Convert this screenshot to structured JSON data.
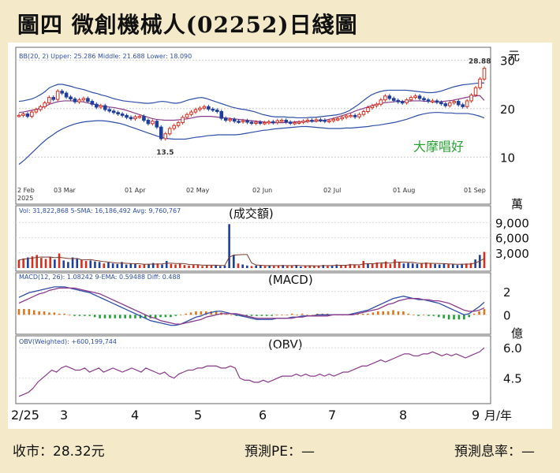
{
  "title": "圖四  微創機械人(02252)日綫圖",
  "footer": {
    "close_label": "收市：28.32元",
    "pe_label": "預測PE：—",
    "yield_label": "預測息率：—"
  },
  "colors": {
    "up": "#d62f1e",
    "down": "#1f3f9e",
    "band": "#2f4fa8",
    "middle": "#8b3a8b",
    "green": "#21a136",
    "orange": "#e0761c",
    "accent": "#2aa335"
  },
  "chart_data": [
    {
      "type": "line",
      "panel": "price",
      "legend_text": "BB(20, 2)  Upper: 25.286  Middle: 21.688  Lower: 18.090",
      "ytick_labels": [
        "30",
        "20",
        "10"
      ],
      "yticks": [
        30,
        20,
        10
      ],
      "ylim": [
        5,
        32
      ],
      "y_unit_label": "元",
      "x_date_labels": [
        "2 Feb",
        "03 Mar",
        "01 Apr",
        "02 May",
        "02 Jun",
        "02 Jul",
        "01 Aug",
        "01 Sep"
      ],
      "x_year_label": "2025",
      "annotations": [
        "13.5",
        "28.88"
      ],
      "caption": "大摩唱好",
      "close_prices": [
        18.6,
        18.9,
        18.4,
        19.3,
        19.8,
        20.4,
        21.2,
        22.3,
        21.9,
        23.6,
        23.2,
        22.4,
        22.0,
        21.4,
        21.8,
        22.1,
        21.5,
        20.9,
        20.3,
        20.6,
        19.8,
        19.5,
        19.2,
        18.9,
        18.6,
        18.2,
        17.9,
        18.3,
        18.4,
        17.6,
        16.9,
        17.4,
        16.2,
        13.8,
        14.8,
        15.9,
        16.5,
        17.1,
        18.2,
        18.8,
        19.3,
        19.8,
        20.1,
        20.4,
        19.9,
        19.7,
        19.4,
        18.0,
        17.6,
        17.8,
        17.4,
        17.3,
        17.5,
        17.2,
        17.0,
        17.2,
        17.0,
        17.1,
        17.3,
        17.1,
        17.5,
        17.6,
        17.2,
        17.0,
        17.1,
        17.2,
        17.4,
        17.6,
        17.5,
        17.7,
        17.6,
        17.4,
        17.5,
        17.8,
        17.9,
        18.2,
        18.5,
        18.6,
        18.3,
        18.8,
        19.4,
        20.2,
        20.6,
        20.9,
        21.8,
        22.6,
        22.1,
        21.7,
        21.4,
        21.2,
        21.8,
        22.3,
        22.6,
        22.1,
        21.8,
        21.5,
        21.6,
        21.3,
        21.0,
        20.6,
        21.2,
        21.5,
        20.8,
        20.4,
        21.6,
        22.8,
        24.3,
        26.1,
        28.32
      ],
      "bb_upper": [
        21.5,
        21.6,
        21.8,
        22.0,
        22.4,
        22.9,
        23.5,
        24.3,
        24.7,
        25.0,
        25.0,
        24.8,
        24.6,
        24.3,
        24.1,
        23.9,
        23.6,
        23.3,
        23.1,
        22.8,
        22.6,
        22.3,
        22.0,
        21.8,
        21.6,
        21.5,
        21.4,
        21.3,
        21.2,
        21.1,
        21.1,
        21.2,
        21.4,
        21.5,
        21.4,
        21.2,
        21.1,
        21.2,
        21.5,
        21.8,
        22.0,
        22.2,
        22.3,
        22.1,
        21.8,
        21.5,
        21.2,
        20.9,
        20.6,
        20.3,
        20.1,
        19.9,
        19.8,
        19.6,
        19.4,
        19.1,
        18.8,
        18.6,
        18.4,
        18.3,
        18.3,
        18.3,
        18.2,
        18.2,
        18.1,
        18.1,
        18.1,
        18.2,
        18.2,
        18.3,
        18.4,
        18.5,
        18.6,
        18.7,
        18.9,
        19.2,
        19.6,
        20.2,
        20.8,
        21.5,
        22.2,
        22.8,
        23.2,
        23.5,
        23.7,
        23.8,
        23.8,
        23.8,
        23.8,
        23.8,
        23.7,
        23.6,
        23.5,
        23.4,
        23.3,
        23.3,
        23.4,
        23.6,
        23.9,
        24.2,
        24.5,
        24.7,
        24.9,
        25.0,
        25.1,
        25.2,
        25.3,
        25.286
      ],
      "bb_middle": [
        19.2,
        19.3,
        19.5,
        19.7,
        19.9,
        20.2,
        20.6,
        21.0,
        21.3,
        21.5,
        21.6,
        21.6,
        21.6,
        21.5,
        21.4,
        21.2,
        21.0,
        20.8,
        20.6,
        20.4,
        20.3,
        20.2,
        20.0,
        19.8,
        19.5,
        19.2,
        18.9,
        18.6,
        18.3,
        18.0,
        17.8,
        17.7,
        17.6,
        17.6,
        17.6,
        17.7,
        17.8,
        17.9,
        18.1,
        18.3,
        18.4,
        18.4,
        18.4,
        18.3,
        18.2,
        18.1,
        18.0,
        17.9,
        17.8,
        17.7,
        17.6,
        17.5,
        17.4,
        17.3,
        17.2,
        17.1,
        17.1,
        17.1,
        17.1,
        17.2,
        17.2,
        17.3,
        17.3,
        17.3,
        17.4,
        17.4,
        17.5,
        17.6,
        17.8,
        18.0,
        18.3,
        18.6,
        18.9,
        19.2,
        19.6,
        19.9,
        20.2,
        20.5,
        20.8,
        21.0,
        21.2,
        21.3,
        21.4,
        21.5,
        21.5,
        21.5,
        21.6,
        21.6,
        21.6,
        21.5,
        21.5,
        21.4,
        21.4,
        21.5,
        21.6,
        21.7,
        21.9,
        22.1,
        22.3,
        22.5,
        22.6,
        22.7,
        21.688
      ],
      "bb_lower": [
        8.5,
        9.4,
        10.5,
        11.6,
        12.7,
        13.7,
        14.5,
        15.3,
        15.9,
        16.4,
        16.8,
        17.1,
        17.3,
        17.4,
        17.5,
        17.5,
        17.4,
        17.2,
        17.0,
        16.7,
        16.3,
        15.9,
        15.5,
        15.1,
        14.7,
        14.3,
        14.0,
        13.8,
        13.7,
        13.7,
        13.7,
        13.9,
        14.1,
        14.2,
        14.4,
        14.5,
        14.6,
        14.6,
        14.6,
        14.6,
        14.7,
        14.9,
        15.1,
        15.3,
        15.5,
        15.6,
        15.8,
        15.9,
        16.0,
        16.1,
        16.2,
        16.3,
        16.3,
        16.2,
        16.1,
        16.0,
        15.9,
        15.9,
        15.9,
        16.0,
        16.0,
        16.1,
        16.2,
        16.3,
        16.5,
        16.6,
        16.8,
        17.0,
        17.2,
        17.5,
        17.8,
        18.2,
        18.6,
        18.9,
        19.1,
        19.2,
        19.2,
        19.1,
        19.1,
        19.0,
        19.0,
        19.0,
        18.8,
        18.5,
        18.09
      ]
    },
    {
      "type": "bar",
      "panel": "volume",
      "legend_text": "Vol: 31,822,868  5-SMA: 16,186,492  Avg: 9,760,767",
      "caption": "(成交額)",
      "ytick_labels": [
        "9,000",
        "6,000",
        "3,000"
      ],
      "yticks": [
        9000,
        6000,
        3000
      ],
      "ylim": [
        0,
        10000
      ],
      "y_unit_label": "萬",
      "values": [
        1600,
        1900,
        2100,
        2300,
        2600,
        2000,
        1800,
        2200,
        1700,
        2900,
        1500,
        1200,
        2100,
        1800,
        1600,
        1400,
        1500,
        1300,
        1200,
        900,
        1100,
        900,
        800,
        1200,
        700,
        900,
        800,
        600,
        700,
        800,
        1000,
        900,
        700,
        1400,
        800,
        700,
        900,
        600,
        500,
        600,
        700,
        400,
        600,
        500,
        600,
        400,
        500,
        8700,
        2600,
        900,
        700,
        500,
        400,
        500,
        600,
        400,
        500,
        400,
        500,
        600,
        400,
        500,
        600,
        300,
        400,
        500,
        400,
        500,
        600,
        400,
        500,
        700,
        500,
        600,
        800,
        700,
        500,
        1400,
        900,
        800,
        1100,
        900,
        1300,
        800,
        1700,
        1200,
        900,
        1000,
        900,
        800,
        1000,
        1100,
        900,
        800,
        700,
        900,
        800,
        700,
        600,
        800,
        900,
        1000,
        1700,
        2600,
        3200
      ]
    },
    {
      "type": "line",
      "panel": "macd",
      "legend_text": "MACD(12, 26): 1.08242  9-EMA: 0.59488  Diff: 0.488",
      "caption": "(MACD)",
      "ytick_labels": [
        "2",
        "0"
      ],
      "yticks": [
        2,
        0
      ],
      "ylim": [
        -1.4,
        2.8
      ],
      "series": [
        {
          "key": "macd",
          "values": [
            1.5,
            1.7,
            1.9,
            2.0,
            2.1,
            2.2,
            2.3,
            2.4,
            2.4,
            2.4,
            2.3,
            2.2,
            2.1,
            2.0,
            1.9,
            1.7,
            1.5,
            1.3,
            1.1,
            0.9,
            0.7,
            0.5,
            0.3,
            0.1,
            -0.1,
            -0.3,
            -0.5,
            -0.6,
            -0.7,
            -0.8,
            -0.9,
            -0.9,
            -0.8,
            -0.6,
            -0.4,
            -0.2,
            -0.1,
            0.1,
            0.2,
            0.3,
            0.3,
            0.2,
            0.1,
            0.0,
            -0.1,
            -0.2,
            -0.3,
            -0.4,
            -0.4,
            -0.4,
            -0.4,
            -0.3,
            -0.3,
            -0.3,
            -0.2,
            -0.2,
            -0.1,
            -0.1,
            -0.1,
            0.0,
            0.0,
            0.0,
            0.0,
            0.0,
            0.0,
            0.0,
            0.1,
            0.2,
            0.3,
            0.4,
            0.6,
            0.8,
            1.0,
            1.2,
            1.4,
            1.5,
            1.6,
            1.5,
            1.4,
            1.3,
            1.3,
            1.2,
            1.1,
            1.0,
            0.8,
            0.6,
            0.4,
            0.2,
            0.0,
            0.1,
            0.4,
            0.7,
            1.08
          ]
        },
        {
          "key": "signal",
          "values": [
            1.0,
            1.2,
            1.4,
            1.6,
            1.8,
            1.9,
            2.1,
            2.2,
            2.3,
            2.3,
            2.3,
            2.3,
            2.2,
            2.1,
            2.0,
            1.9,
            1.8,
            1.6,
            1.4,
            1.2,
            1.0,
            0.8,
            0.6,
            0.4,
            0.2,
            0.0,
            -0.2,
            -0.3,
            -0.5,
            -0.6,
            -0.7,
            -0.8,
            -0.8,
            -0.7,
            -0.6,
            -0.5,
            -0.4,
            -0.2,
            -0.1,
            0.0,
            0.1,
            0.1,
            0.1,
            0.1,
            0.0,
            -0.1,
            -0.2,
            -0.3,
            -0.3,
            -0.3,
            -0.3,
            -0.3,
            -0.3,
            -0.3,
            -0.3,
            -0.2,
            -0.2,
            -0.1,
            -0.1,
            -0.1,
            -0.1,
            -0.1,
            0.0,
            0.0,
            0.0,
            0.0,
            0.0,
            0.1,
            0.2,
            0.3,
            0.4,
            0.5,
            0.7,
            0.9,
            1.0,
            1.2,
            1.3,
            1.4,
            1.4,
            1.4,
            1.3,
            1.3,
            1.2,
            1.2,
            1.1,
            1.0,
            0.8,
            0.6,
            0.4,
            0.3,
            0.3,
            0.4,
            0.59488
          ]
        },
        {
          "key": "diff",
          "values": [
            0.5,
            0.5,
            0.5,
            0.4,
            0.3,
            0.3,
            0.2,
            0.2,
            0.1,
            0.1,
            0.0,
            -0.1,
            -0.1,
            -0.1,
            -0.1,
            -0.2,
            -0.3,
            -0.3,
            -0.3,
            -0.3,
            -0.3,
            -0.3,
            -0.3,
            -0.3,
            -0.3,
            -0.3,
            -0.3,
            -0.3,
            -0.2,
            -0.2,
            -0.2,
            -0.1,
            0.0,
            0.1,
            0.2,
            0.3,
            0.3,
            0.3,
            0.3,
            0.3,
            0.2,
            0.1,
            0.0,
            -0.1,
            -0.1,
            -0.1,
            -0.1,
            -0.1,
            -0.1,
            -0.1,
            -0.1,
            0.0,
            0.0,
            0.0,
            0.1,
            0.0,
            0.1,
            0.0,
            0.0,
            0.1,
            0.1,
            0.1,
            0.0,
            0.0,
            0.0,
            0.0,
            0.1,
            0.1,
            0.1,
            0.1,
            0.2,
            0.3,
            0.3,
            0.3,
            0.4,
            0.3,
            0.3,
            0.1,
            0.0,
            -0.1,
            0.0,
            -0.1,
            -0.1,
            -0.2,
            -0.3,
            -0.4,
            -0.4,
            -0.4,
            -0.4,
            -0.2,
            0.1,
            0.3,
            0.488
          ]
        }
      ]
    },
    {
      "type": "line",
      "panel": "obv",
      "legend_text": "OBV(Weighted): +600,199,744",
      "caption": "(OBV)",
      "ytick_labels": [
        "6.0",
        "4.5"
      ],
      "yticks": [
        6.0,
        4.5
      ],
      "ylim": [
        3.4,
        6.2
      ],
      "y_unit_label": "億",
      "values": [
        3.6,
        3.7,
        3.8,
        4.0,
        4.3,
        4.5,
        4.7,
        4.9,
        4.8,
        5.0,
        5.1,
        5.0,
        4.9,
        4.9,
        5.0,
        4.8,
        4.9,
        5.0,
        4.8,
        4.9,
        5.0,
        4.9,
        4.8,
        4.9,
        5.0,
        4.9,
        4.8,
        5.0,
        4.9,
        4.8,
        4.7,
        4.8,
        4.6,
        4.5,
        4.7,
        4.8,
        4.9,
        4.9,
        5.0,
        5.0,
        5.1,
        5.1,
        5.1,
        5.0,
        5.0,
        5.1,
        5.0,
        4.5,
        4.4,
        4.4,
        4.3,
        4.3,
        4.4,
        4.3,
        4.4,
        4.5,
        4.6,
        4.6,
        4.6,
        4.7,
        4.6,
        4.7,
        4.6,
        4.6,
        4.7,
        4.6,
        4.7,
        4.6,
        4.7,
        4.8,
        4.8,
        4.9,
        5.0,
        5.1,
        5.1,
        5.2,
        5.3,
        5.4,
        5.3,
        5.4,
        5.5,
        5.6,
        5.7,
        5.7,
        5.6,
        5.6,
        5.7,
        5.7,
        5.8,
        5.7,
        5.6,
        5.7,
        5.6,
        5.7,
        5.6,
        5.5,
        5.6,
        5.7,
        5.8,
        6.0
      ]
    }
  ],
  "bottom_axis": {
    "labels": [
      "2/25",
      "3",
      "4",
      "5",
      "6",
      "7",
      "8",
      "9"
    ],
    "unit_label": "月/年"
  }
}
